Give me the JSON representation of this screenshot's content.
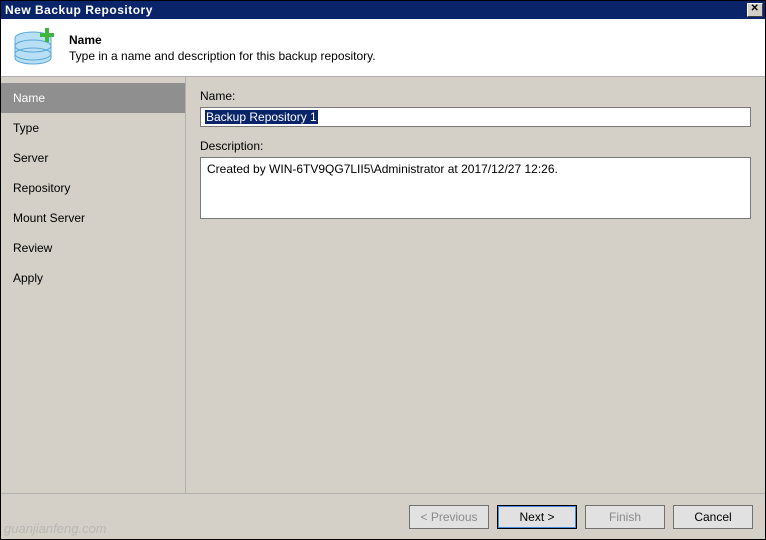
{
  "window": {
    "title": "New Backup Repository"
  },
  "header": {
    "title": "Name",
    "description": "Type in a name and description for this backup repository."
  },
  "sidebar": {
    "items": [
      {
        "label": "Name",
        "active": true
      },
      {
        "label": "Type",
        "active": false
      },
      {
        "label": "Server",
        "active": false
      },
      {
        "label": "Repository",
        "active": false
      },
      {
        "label": "Mount Server",
        "active": false
      },
      {
        "label": "Review",
        "active": false
      },
      {
        "label": "Apply",
        "active": false
      }
    ]
  },
  "main": {
    "name_label": "Name:",
    "name_value": "Backup Repository 1",
    "description_label": "Description:",
    "description_value": "Created by WIN-6TV9QG7LII5\\Administrator at 2017/12/27 12:26."
  },
  "footer": {
    "previous": "< Previous",
    "next": "Next >",
    "finish": "Finish",
    "cancel": "Cancel"
  },
  "watermark": "guanjianfeng.com"
}
